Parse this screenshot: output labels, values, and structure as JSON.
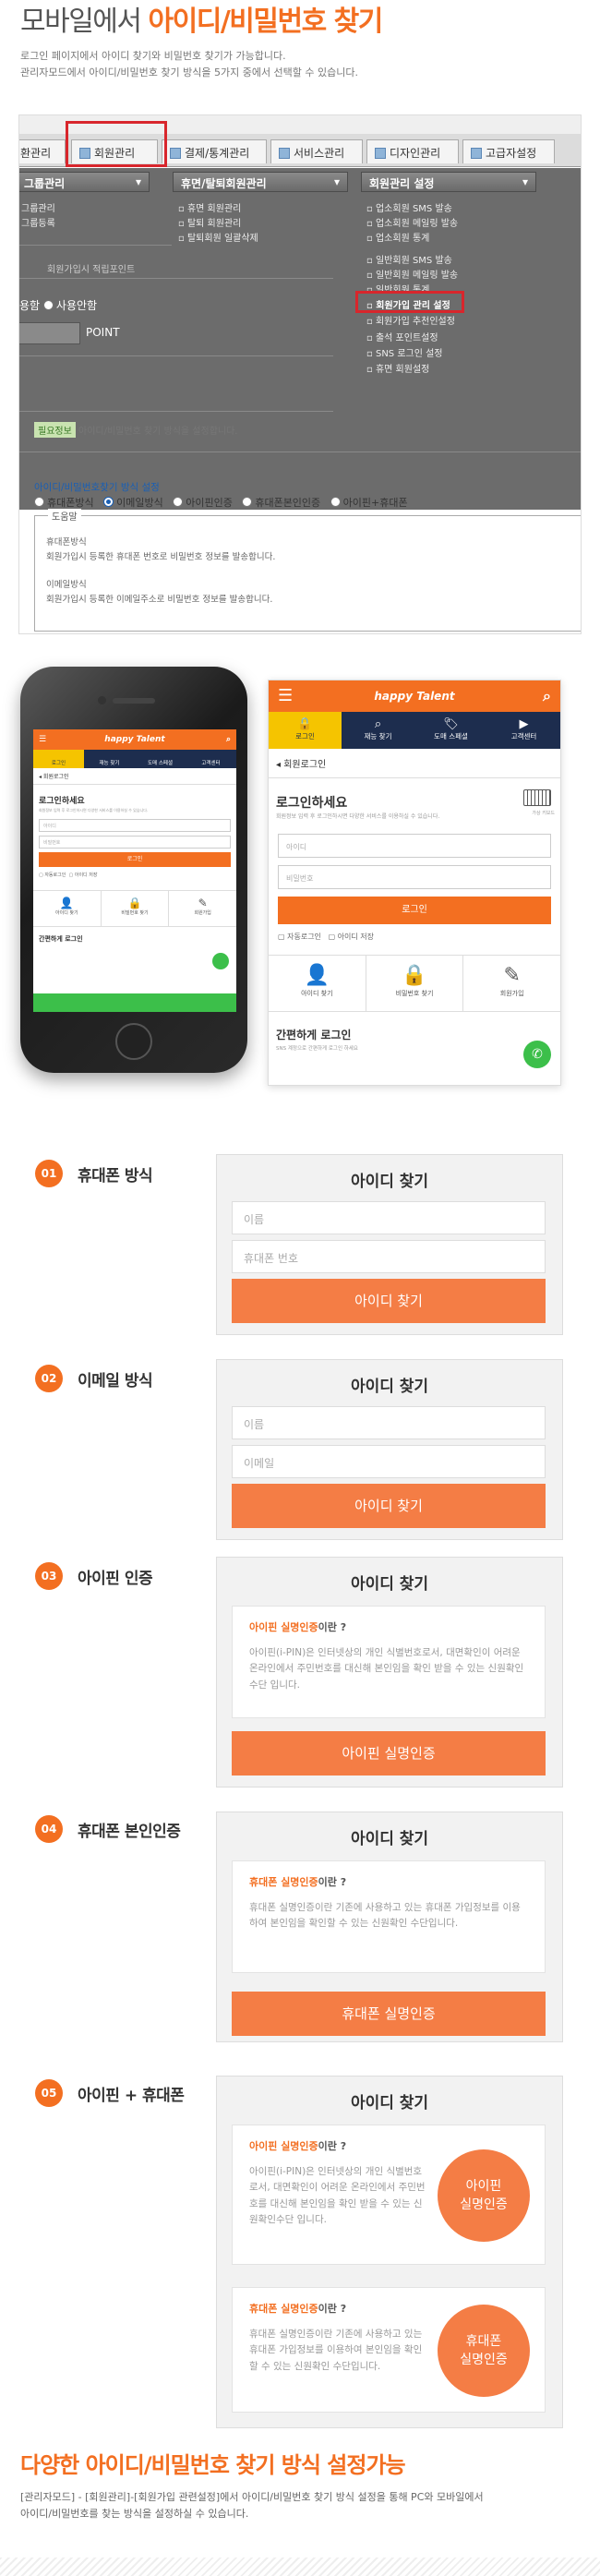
{
  "header": {
    "title_prefix": "모바일에서 ",
    "title_highlight": "아이디/비밀번호 찾기",
    "desc_line1": "로그인 페이지에서 아이디 찾기와 비밀번호 찾기가 가능합니다.",
    "desc_line2": "관리자모드에서 아이디/비밀번호 찾기 방식을 5가지 중에서 선택할 수 있습니다."
  },
  "admin": {
    "tabs": [
      "환관리",
      "회원관리",
      "결제/통계관리",
      "서비스관리",
      "디자인관리",
      "고급자설정"
    ],
    "column_headers": [
      "그룹관리",
      "휴면/탈퇴회원관리",
      "회원관리 설정"
    ],
    "col1_items": [
      "그룹관리",
      "그룹등록"
    ],
    "col2_items": [
      "휴면 회원관리",
      "탈퇴 회원관리",
      "탈퇴회원 일괄삭제"
    ],
    "col3_items": [
      "업소회원 SMS 발송",
      "업소회원 메일링 발송",
      "업소회원 통계",
      "일반회원 SMS 발송",
      "일반회원 메일링 발송",
      "일반회원 통계",
      "회원가입 관리 설정",
      "회원가입 추천인설정",
      "출석 포인트설정",
      "SNS 로그인 설정",
      "휴면 회원설정"
    ],
    "left_label": "회원가입시 적립포인트",
    "left_radio_1": "용함",
    "left_radio_2": "사용안함",
    "left_point_label": "POINT",
    "notice_badge": "필요정보",
    "notice_text": "아이디/비밀번호 찾기 방식을 설정합니다.",
    "setting_title": "아이디/비밀번호찾기 방식 설정",
    "radio_options": [
      "휴대폰방식",
      "이메일방식",
      "아이핀인증",
      "휴대폰본인인증",
      "아이핀+휴대폰"
    ],
    "help_title": "도움말",
    "help_phone_title": "휴대폰방식",
    "help_phone_text": "회원가입시 등록한 휴대폰 번호로 비밀번호 정보를 발송합니다.",
    "help_email_title": "이메일방식",
    "help_email_text": "회원가입시 등록한 이메일주소로 비밀번호 정보를 발송합니다."
  },
  "mobile": {
    "brand": "happy Talent",
    "nav": [
      "로그인",
      "재능 찾기",
      "도매 스페셜",
      "고객센터"
    ],
    "breadcrumb": "회원로그인",
    "login_title": "로그인하세요",
    "login_sub": "회원정보 입력 후 로그인하시면 다양한 서비스를 이용하실 수 있습니다.",
    "keyboard_label": "가상 키보드",
    "id_placeholder": "아이디",
    "pw_placeholder": "비밀번호",
    "login_button": "로그인",
    "auto_login": "자동로그인",
    "save_id": "아이디 저장",
    "find_id": "아이디 찾기",
    "find_pw": "비밀번호 찾기",
    "join": "회원가입",
    "easy_login": "간편하게 로그인",
    "easy_login_sub": "SNS 계정으로 간편하게 로그인 하세요"
  },
  "methods": [
    {
      "num": "01",
      "label": "휴대폰 방식",
      "card_title": "아이디 찾기",
      "fields": [
        "이름",
        "휴대폰 번호"
      ],
      "button": "아이디 찾기"
    },
    {
      "num": "02",
      "label": "이메일 방식",
      "card_title": "아이디 찾기",
      "fields": [
        "이름",
        "이메일"
      ],
      "button": "아이디 찾기"
    },
    {
      "num": "03",
      "label": "아이핀 인증",
      "card_title": "아이디 찾기",
      "info_highlight": "아이핀 실명인증",
      "info_suffix": "이란 ?",
      "info_body": "아이핀(i-PIN)은 인터넷상의 개인 식별번호로서, 대면확인이 어려운 온라인에서 주민번호를 대신해 본인임을 확인 받을 수 있는 신원확인수단 입니다.",
      "button": "아이핀 실명인증"
    },
    {
      "num": "04",
      "label": "휴대폰 본인인증",
      "card_title": "아이디 찾기",
      "info_highlight": "휴대폰 실명인증",
      "info_suffix": "이란 ?",
      "info_body": "휴대폰 실명인증이란 기존에 사용하고 있는 휴대폰 가입정보를 이용하여 본인임을 확인할 수 있는 신원확인 수단입니다.",
      "button": "휴대폰 실명인증"
    },
    {
      "num": "05",
      "label": "아이핀 + 휴대폰",
      "card_title": "아이디 찾기",
      "info1_highlight": "아이핀 실명인증",
      "info1_suffix": "이란 ?",
      "info1_body": "아이핀(i-PIN)은 인터넷상의 개인 식별번호로서, 대면확인이 어려운 온라인에서 주민번호를 대신해 본인임을 확인 받을 수 있는 신원확인수단 입니다.",
      "circle1": "아이핀\n실명인증",
      "info2_highlight": "휴대폰 실명인증",
      "info2_suffix": "이란 ?",
      "info2_body": "휴대폰 실명인증이란 기존에 사용하고 있는 휴대폰 가입정보를 이용하여 본인임을 확인할 수 있는 신원확인 수단입니다.",
      "circle2": "휴대폰\n실명인증"
    }
  ],
  "footer": {
    "title": "다양한 아이디/비밀번호 찾기 방식 설정가능",
    "desc_line1": "[관리자모드] - [회원관리]-[회원가입 관련설정]에서 아이디/비밀번호 찾기 방식 설정을 통해 PC와 모바일에서",
    "desc_line2": "아이디/비밀번호를 찾는 방식을 설정하실 수 있습니다."
  },
  "colors": {
    "accent": "#f36f21",
    "navy": "#1d2d4e",
    "yellow": "#f5c400",
    "highlight_border": "#d8262c"
  }
}
